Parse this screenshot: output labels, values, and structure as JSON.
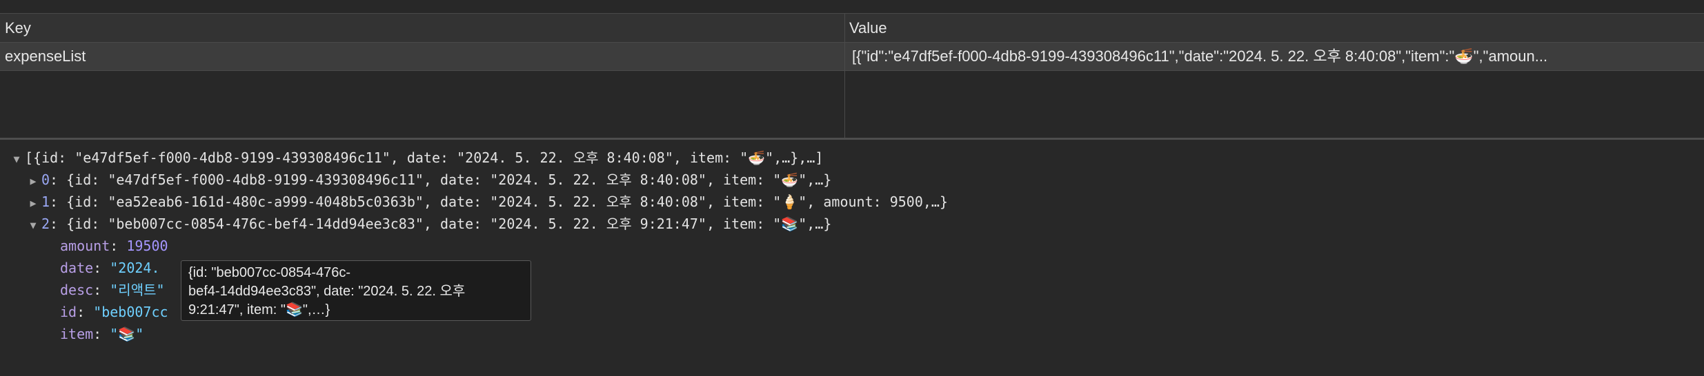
{
  "table": {
    "headers": {
      "key": "Key",
      "value": "Value"
    },
    "rows": [
      {
        "key": "expenseList",
        "value": "[{\"id\":\"e47df5ef-f000-4db8-9199-439308496c11\",\"date\":\"2024. 5. 22. 오후 8:40:08\",\"item\":\"🍜\",\"amoun..."
      }
    ]
  },
  "preview": {
    "root_summary": "[{id: \"e47df5ef-f000-4db8-9199-439308496c11\", date: \"2024. 5. 22. 오후 8:40:08\", item: \"🍜\",…},…]",
    "items": [
      {
        "index": "0",
        "summary": "{id: \"e47df5ef-f000-4db8-9199-439308496c11\", date: \"2024. 5. 22. 오후 8:40:08\", item: \"🍜\",…}"
      },
      {
        "index": "1",
        "summary": "{id: \"ea52eab6-161d-480c-a999-4048b5c0363b\", date: \"2024. 5. 22. 오후 8:40:08\", item: \"🍦\", amount: 9500,…}"
      },
      {
        "index": "2",
        "summary": "{id: \"beb007cc-0854-476c-bef4-14dd94ee3c83\", date: \"2024. 5. 22. 오후 9:21:47\", item: \"📚\",…}"
      }
    ],
    "expanded_props": [
      {
        "name": "amount",
        "value": "19500",
        "kind": "num"
      },
      {
        "name": "date",
        "value": "\"2024.",
        "kind": "str"
      },
      {
        "name": "desc",
        "value": "\"리액트\"",
        "kind": "str"
      },
      {
        "name": "id",
        "value": "\"beb007cc",
        "kind": "str"
      },
      {
        "name": "item",
        "value": "\"📚\"",
        "kind": "str"
      }
    ]
  },
  "tooltip": {
    "lines": [
      "{id: \"beb007cc-0854-476c-",
      "bef4-14dd94ee3c83\", date: \"2024. 5. 22. 오후",
      "9:21:47\", item: \"📚\",…}"
    ]
  },
  "icons": {
    "expanded": "triangle-down-icon",
    "collapsed": "triangle-right-icon"
  },
  "colors": {
    "background": "#282828",
    "header_bg": "#333333",
    "row_selected_bg": "#3d3d3d",
    "string": "#6fd0ff",
    "number": "#a596ff",
    "property": "#b89fe6"
  }
}
